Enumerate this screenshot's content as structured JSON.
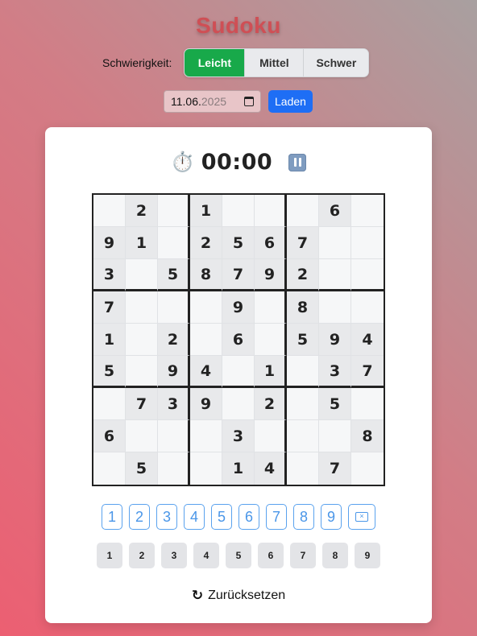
{
  "app": {
    "title": "Sudoku"
  },
  "difficulty": {
    "label": "Schwierigkeit:",
    "options": [
      "Leicht",
      "Mittel",
      "Schwer"
    ],
    "selected": "Leicht"
  },
  "date": {
    "value_day_month": "11.06.",
    "value_year": "2025",
    "load_label": "Laden"
  },
  "timer": {
    "icon": "stopwatch-icon",
    "time": "00:00",
    "pause_icon": "pause-icon"
  },
  "board": [
    [
      "",
      "2",
      "",
      "1",
      "",
      "",
      "",
      "6",
      ""
    ],
    [
      "9",
      "1",
      "",
      "2",
      "5",
      "6",
      "7",
      "",
      ""
    ],
    [
      "3",
      "",
      "5",
      "8",
      "7",
      "9",
      "2",
      "",
      ""
    ],
    [
      "7",
      "",
      "",
      "",
      "9",
      "",
      "8",
      "",
      ""
    ],
    [
      "1",
      "",
      "2",
      "",
      "6",
      "",
      "5",
      "9",
      "4"
    ],
    [
      "5",
      "",
      "9",
      "4",
      "",
      "1",
      "",
      "3",
      "7"
    ],
    [
      "",
      "7",
      "3",
      "9",
      "",
      "2",
      "",
      "5",
      ""
    ],
    [
      "6",
      "",
      "",
      "",
      "3",
      "",
      "",
      "",
      "8"
    ],
    [
      "",
      "5",
      "",
      "",
      "1",
      "4",
      "",
      "7",
      ""
    ]
  ],
  "number_pad": [
    "1",
    "2",
    "3",
    "4",
    "5",
    "6",
    "7",
    "8",
    "9"
  ],
  "erase": {
    "icon": "backspace-icon"
  },
  "notes_pad": [
    "1",
    "2",
    "3",
    "4",
    "5",
    "6",
    "7",
    "8",
    "9"
  ],
  "reset": {
    "icon": "refresh-icon",
    "label": "Zurücksetzen"
  },
  "colors": {
    "active": "#18a94a",
    "load": "#1e6ef5",
    "pad": "#4a96e8",
    "title": "#cf4f55"
  }
}
